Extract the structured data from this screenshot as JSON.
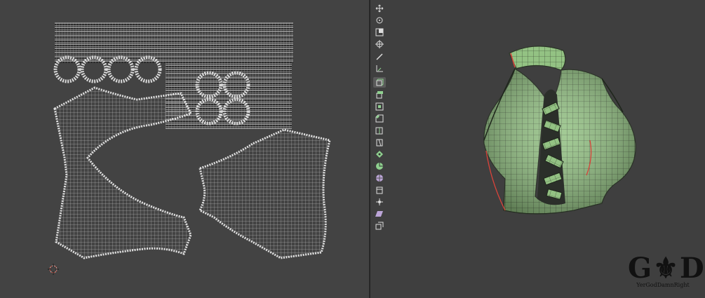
{
  "uv_editor": {
    "name": "uv-editor"
  },
  "viewport": {
    "toolbar_tools": [
      {
        "icon": "move-icon"
      },
      {
        "icon": "rotate-icon"
      },
      {
        "icon": "scale-icon"
      },
      {
        "icon": "transform-icon"
      },
      {
        "icon": "annotate-icon"
      },
      {
        "icon": "measure-icon"
      },
      {
        "icon": "add-cube-icon"
      },
      {
        "icon": "extrude-region-icon"
      },
      {
        "icon": "inset-faces-icon"
      },
      {
        "icon": "bevel-icon"
      },
      {
        "icon": "loop-cut-icon"
      },
      {
        "icon": "knife-icon"
      },
      {
        "icon": "poly-build-icon"
      },
      {
        "icon": "spin-icon"
      },
      {
        "icon": "smooth-icon"
      },
      {
        "icon": "edge-slide-icon"
      },
      {
        "icon": "shrink-fatten-icon"
      },
      {
        "icon": "shear-icon"
      },
      {
        "icon": "rip-region-icon"
      }
    ]
  },
  "colors": {
    "uv_bg": "#434343",
    "viewport_bg": "#3f3f3f",
    "mesh_green": "#8fbf7e",
    "seam_red": "#d9433a"
  },
  "logo": {
    "mark": "G⚜D",
    "text": "YerGodDamnRight"
  }
}
